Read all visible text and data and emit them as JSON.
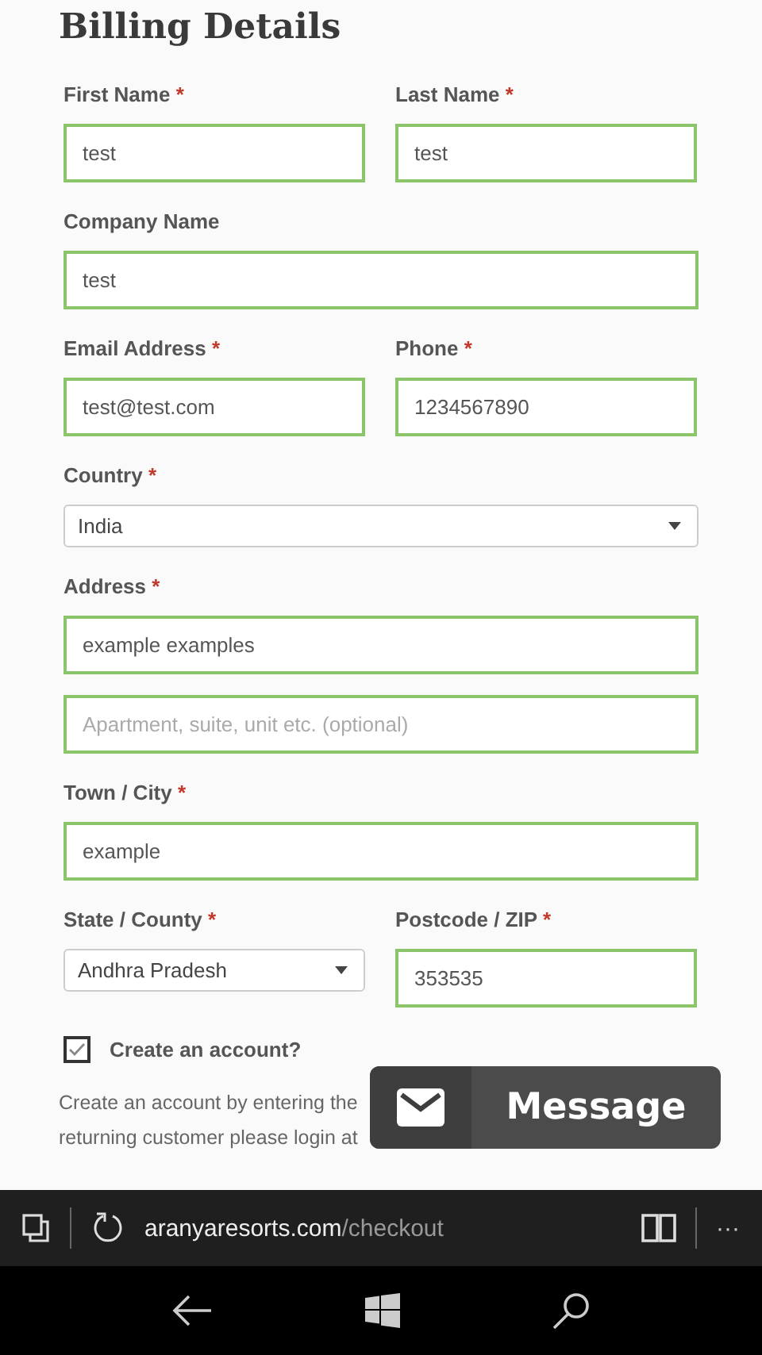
{
  "title": "Billing Details",
  "rows": [
    {
      "fields": [
        {
          "label": "First Name",
          "required_mark": "*",
          "kind": "input",
          "value": "test"
        },
        {
          "label": "Last Name",
          "required_mark": "*",
          "kind": "input",
          "value": "test"
        }
      ]
    },
    {
      "fields": [
        {
          "label": "Company Name",
          "kind": "input",
          "value": "test"
        }
      ]
    },
    {
      "fields": [
        {
          "label": "Email Address",
          "required_mark": "*",
          "kind": "input",
          "value": "test@test.com"
        },
        {
          "label": "Phone",
          "required_mark": "*",
          "kind": "input",
          "value": "1234567890"
        }
      ]
    },
    {
      "fields": [
        {
          "label": "Country",
          "required_mark": "*",
          "kind": "select",
          "value": "India"
        }
      ]
    },
    {
      "fields": [
        {
          "label": "Address",
          "required_mark": "*",
          "kind": "input",
          "value": "example examples"
        }
      ]
    },
    {
      "fields": [
        {
          "kind": "input",
          "placeholder": "Apartment, suite, unit etc. (optional)"
        }
      ]
    },
    {
      "fields": [
        {
          "label": "Town / City",
          "required_mark": "*",
          "kind": "input",
          "value": "example"
        }
      ]
    },
    {
      "fields": [
        {
          "label": "State / County",
          "required_mark": "*",
          "kind": "select",
          "value": "Andhra Pradesh"
        },
        {
          "label": "Postcode / ZIP",
          "required_mark": "*",
          "kind": "input",
          "value": "353535"
        }
      ]
    }
  ],
  "create_account": {
    "label": "Create an account?",
    "checked": true
  },
  "note_lines": [
    "Create an account by entering the",
    "returning customer please login at"
  ],
  "message_button": {
    "label": "Message"
  },
  "browser": {
    "url_host": "aranyaresorts.com",
    "url_path": "/checkout",
    "more": "···"
  }
}
